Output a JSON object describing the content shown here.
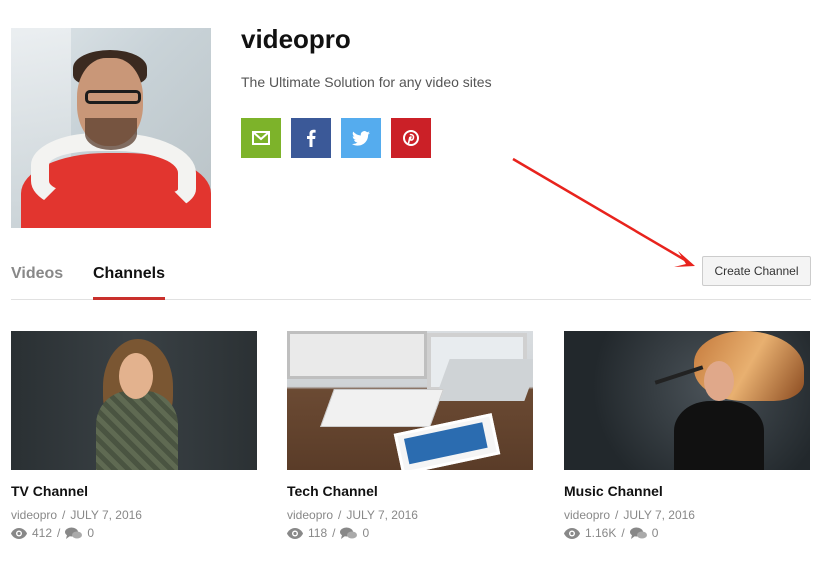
{
  "profile": {
    "name": "videopro",
    "description": "The Ultimate Solution for any video sites"
  },
  "social": [
    {
      "name": "email",
      "color": "#7db32a",
      "icon": "envelope-icon"
    },
    {
      "name": "facebook",
      "color": "#3b5998",
      "icon": "facebook-icon"
    },
    {
      "name": "twitter",
      "color": "#55acee",
      "icon": "twitter-icon"
    },
    {
      "name": "pinterest",
      "color": "#cb2027",
      "icon": "pinterest-icon"
    }
  ],
  "tabs": [
    {
      "label": "Videos",
      "active": false
    },
    {
      "label": "Channels",
      "active": true
    }
  ],
  "create_button": {
    "label": "Create Channel"
  },
  "accent_color": "#c9302c",
  "annotation": {
    "type": "arrow",
    "color": "#e8231d"
  },
  "channels": [
    {
      "title": "TV Channel",
      "author": "videopro",
      "date": "JULY 7, 2016",
      "views": "412",
      "comments": "0"
    },
    {
      "title": "Tech Channel",
      "author": "videopro",
      "date": "JULY 7, 2016",
      "views": "118",
      "comments": "0"
    },
    {
      "title": "Music Channel",
      "author": "videopro",
      "date": "JULY 7, 2016",
      "views": "1.16K",
      "comments": "0"
    }
  ],
  "separators": {
    "slash": "/"
  }
}
